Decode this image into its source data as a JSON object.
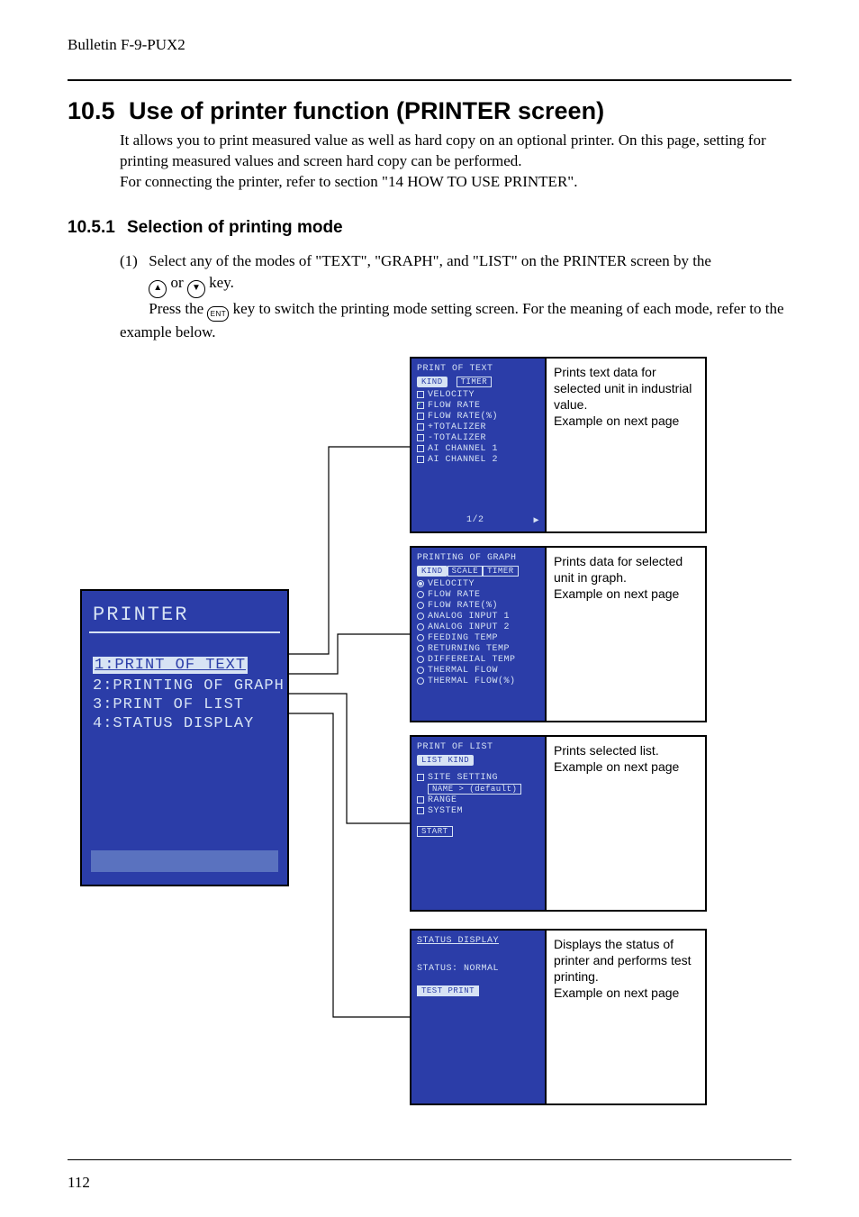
{
  "bulletin": "Bulletin F-9-PUX2",
  "heading": {
    "num": "10.5",
    "title": "Use of printer function (PRINTER screen)"
  },
  "intro": [
    "It allows you to print measured value as well as hard copy on an optional printer.  On this page, setting for printing measured values and screen hard copy can be performed.",
    "For connecting the printer, refer to section \"14 HOW TO USE PRINTER\"."
  ],
  "subheading": {
    "num": "10.5.1",
    "title": "Selection of printing mode"
  },
  "step": {
    "num": "(1)",
    "line1a": "Select any of the modes of \"TEXT\", \"GRAPH\", and \"LIST\" on the PRINTER screen by the",
    "up_key": "▲",
    "or_word": "or",
    "down_key": "▼",
    "line1b": " key.",
    "line2a": "Press the ",
    "ent_key": "ENT",
    "line2b": " key to switch the printing mode setting screen.  For the meaning of each mode, refer to the example below."
  },
  "printer_menu": {
    "title": "PRINTER",
    "items": [
      "1:PRINT OF TEXT",
      "2:PRINTING OF GRAPH",
      "3:PRINT OF LIST",
      "4:STATUS DISPLAY"
    ],
    "selected_index": 0
  },
  "rows": [
    {
      "screen_title": "PRINT OF TEXT",
      "tabs": [
        "KIND",
        "TIMER"
      ],
      "active_tab": 0,
      "items_checkbox": [
        {
          "label": "VELOCITY",
          "checked": false
        },
        {
          "label": "FLOW RATE",
          "checked": true
        },
        {
          "label": "FLOW RATE(%)",
          "checked": false
        },
        {
          "label": "+TOTALIZER",
          "checked": false
        },
        {
          "label": "-TOTALIZER",
          "checked": false
        },
        {
          "label": "AI CHANNEL 1",
          "checked": false
        },
        {
          "label": "AI CHANNEL 2",
          "checked": false
        }
      ],
      "page_indicator": "1/2",
      "right_arrow": "▶",
      "desc": [
        "Prints text data for selected unit in industrial value.",
        "Example on next page"
      ]
    },
    {
      "screen_title": "PRINTING OF GRAPH",
      "tabs": [
        "KIND",
        "SCALE",
        "TIMER"
      ],
      "active_tab": 0,
      "items_radio": [
        {
          "label": "VELOCITY",
          "on": true
        },
        {
          "label": "FLOW RATE",
          "on": false
        },
        {
          "label": "FLOW RATE(%)",
          "on": false
        },
        {
          "label": "ANALOG INPUT 1",
          "on": false
        },
        {
          "label": "ANALOG INPUT 2",
          "on": false
        },
        {
          "label": "FEEDING TEMP",
          "on": false
        },
        {
          "label": "RETURNING TEMP",
          "on": false
        },
        {
          "label": "DIFFEREIAL TEMP",
          "on": false
        },
        {
          "label": "THERMAL FLOW",
          "on": false
        },
        {
          "label": "THERMAL FLOW(%)",
          "on": false
        }
      ],
      "desc": [
        "Prints data for selected unit in graph.",
        "Example on next page"
      ]
    },
    {
      "screen_title": "PRINT OF LIST",
      "section_label": "LIST KIND",
      "items_checkbox": [
        {
          "label": "SITE SETTING",
          "checked": false
        }
      ],
      "name_field": "NAME  > (default)",
      "items_checkbox_after": [
        {
          "label": "RANGE",
          "checked": false
        },
        {
          "label": "SYSTEM",
          "checked": false
        }
      ],
      "start_btn": "START",
      "desc": [
        "Prints selected list.",
        "Example on next page"
      ]
    },
    {
      "screen_title": "STATUS DISPLAY",
      "status_line": "STATUS:  NORMAL",
      "test_btn": "TEST PRINT",
      "desc": [
        "Displays the status of printer and performs test printing.",
        "Example on next page"
      ]
    }
  ],
  "page_number": "112"
}
